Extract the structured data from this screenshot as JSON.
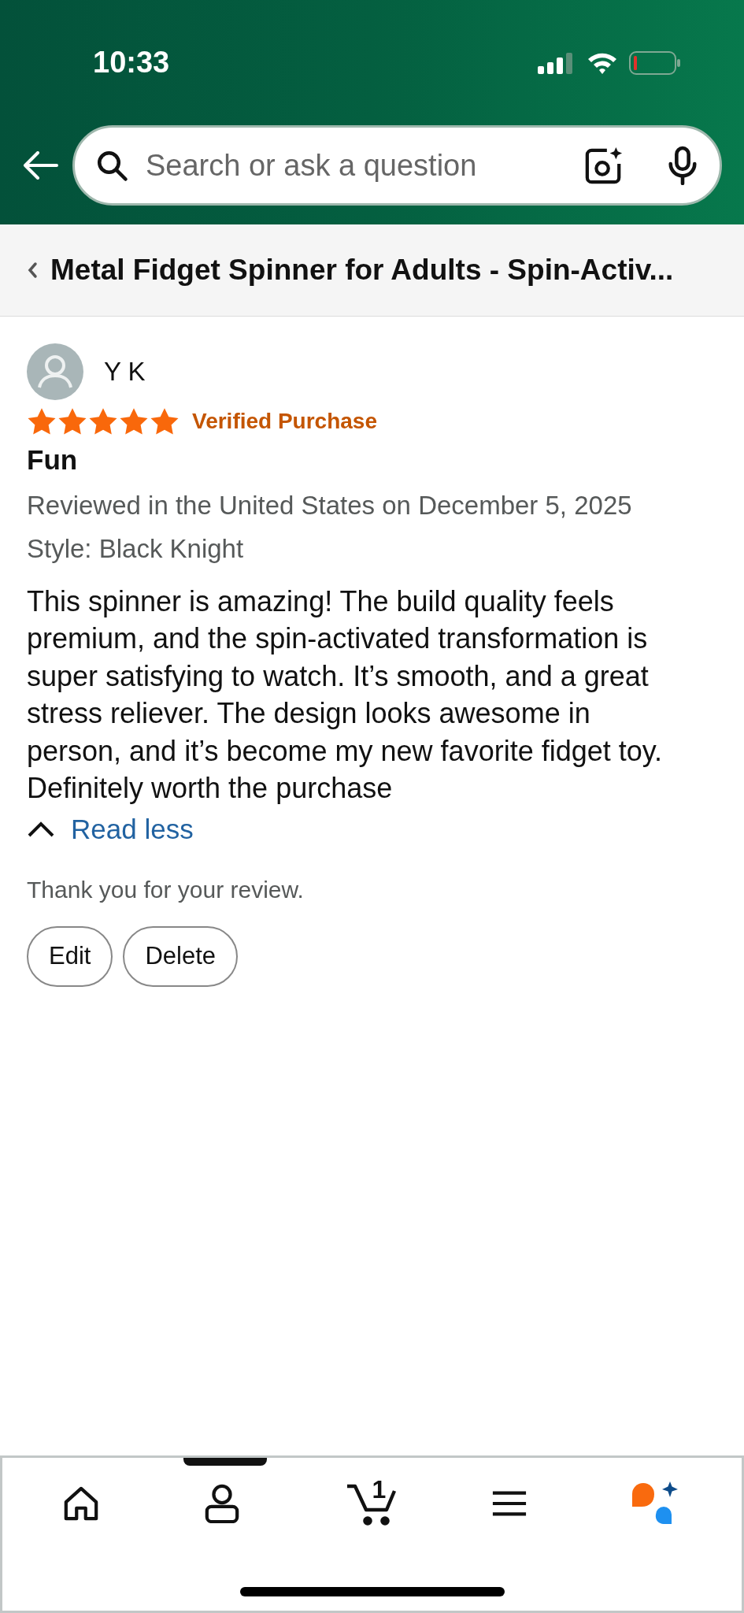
{
  "status_bar": {
    "time": "10:33"
  },
  "search": {
    "placeholder": "Search or ask a question"
  },
  "product_bar": {
    "title": "Metal Fidget Spinner for Adults - Spin-Activ..."
  },
  "review": {
    "reviewer": "Y K",
    "stars": 5,
    "badge": "Verified Purchase",
    "title": "Fun",
    "meta": "Reviewed in the United States on December 5, 2025",
    "style": "Style: Black Knight",
    "body": "This spinner is amazing! The build quality feels premium, and the spin-activated transformation is super satisfying to watch. It’s smooth, and a great stress reliever. The design looks awesome in person, and it’s become my new favorite fidget toy. Definitely worth the purchase",
    "toggle": "Read less",
    "thanks": "Thank you for your review.",
    "buttons": [
      "Edit",
      "Delete"
    ]
  },
  "bottom_nav": {
    "cart_count": "1"
  }
}
